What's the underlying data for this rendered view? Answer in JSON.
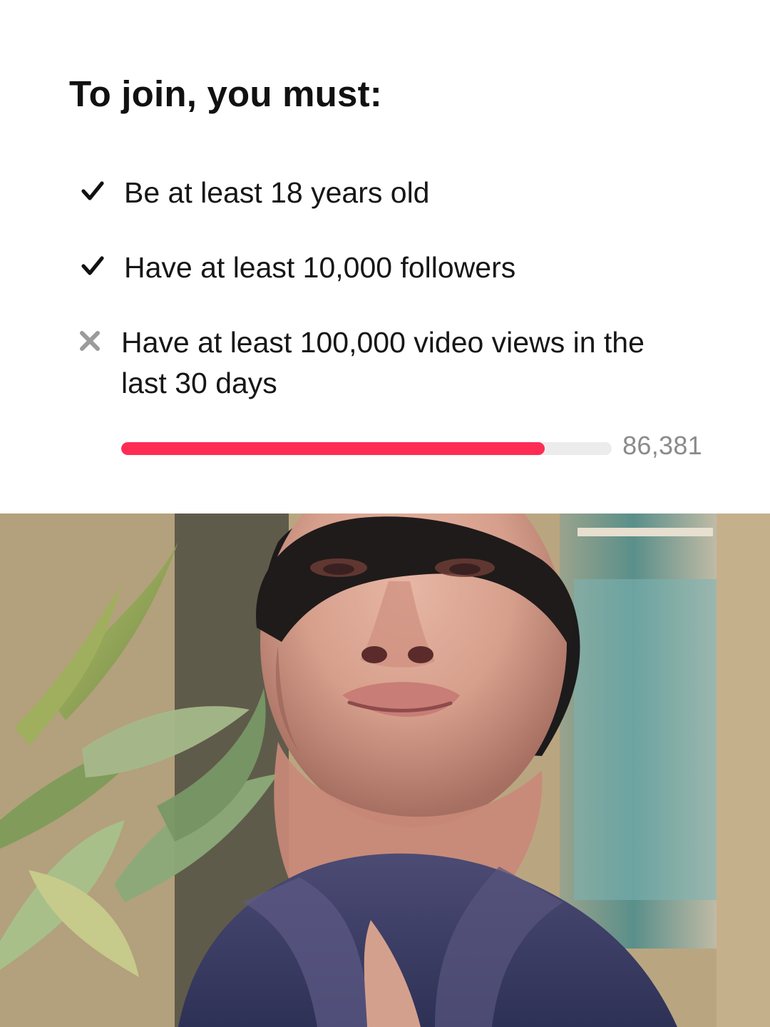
{
  "title": "To join, you must:",
  "requirements": [
    {
      "status": "met",
      "icon": "check-icon",
      "text": "Be at least 18 years old"
    },
    {
      "status": "met",
      "icon": "check-icon",
      "text": "Have at least 10,000 followers"
    },
    {
      "status": "not-met",
      "icon": "x-icon",
      "text": "Have at least 100,000 video views in the last 30 days"
    }
  ],
  "progress": {
    "current": 86381,
    "target": 100000,
    "fraction": 0.8638,
    "display_value": "86,381",
    "fill_color": "#fe2c55"
  },
  "colors": {
    "text": "#111111",
    "muted": "#8a8a8a",
    "accent": "#fe2c55",
    "track": "#ececec"
  }
}
